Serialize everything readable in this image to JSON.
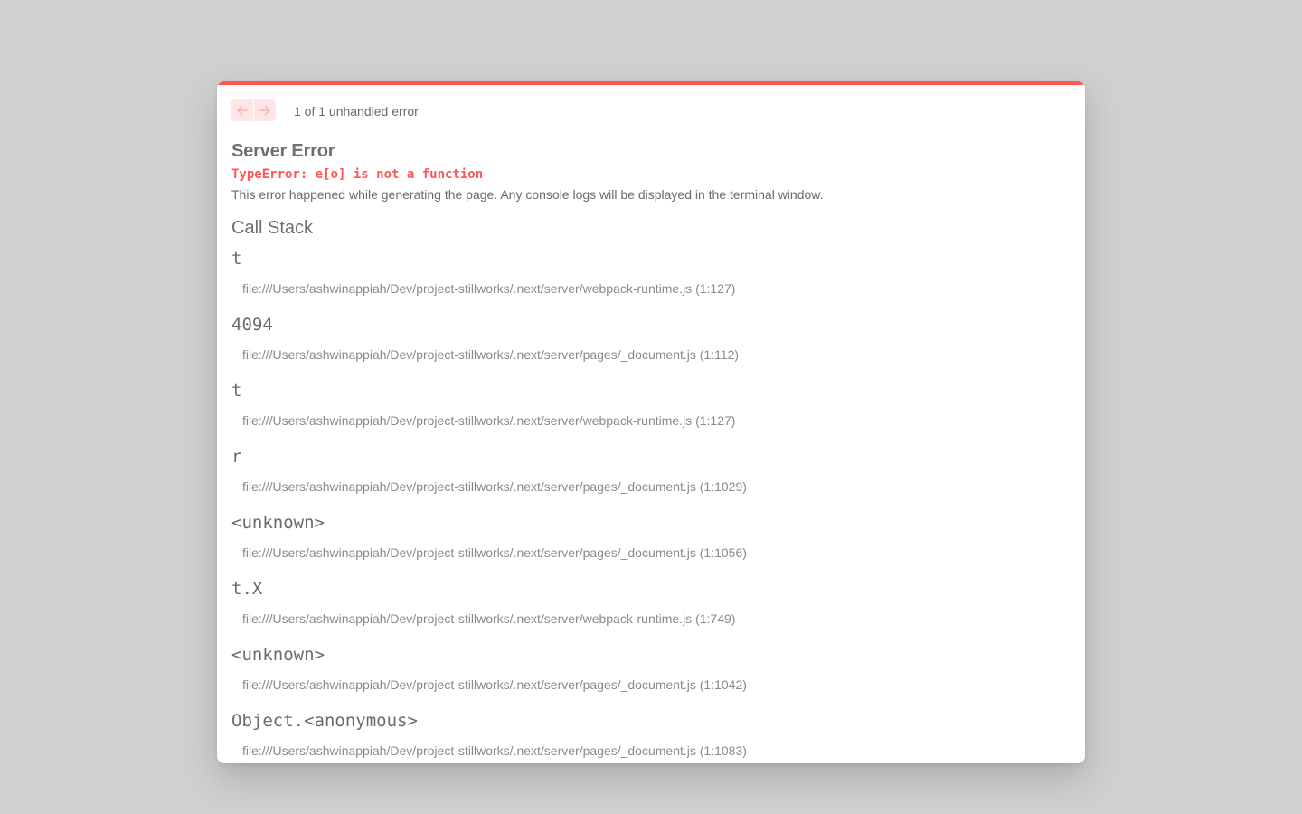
{
  "colors": {
    "accent": "#ff5555",
    "nav_button_bg": "#ffe5e5",
    "overlay_bg": "#d0d0d0",
    "text": "#6b6b6b"
  },
  "nav": {
    "prev_icon": "arrow-left-icon",
    "next_icon": "arrow-right-icon",
    "count_text": "1 of 1 unhandled error"
  },
  "error": {
    "title": "Server Error",
    "message": "TypeError: e[o] is not a function",
    "note": "This error happened while generating the page. Any console logs will be displayed in the terminal window."
  },
  "call_stack": {
    "title": "Call Stack",
    "frames": [
      {
        "fn": "t",
        "location": "file:///Users/ashwinappiah/Dev/project-stillworks/.next/server/webpack-runtime.js (1:127)"
      },
      {
        "fn": "4094",
        "location": "file:///Users/ashwinappiah/Dev/project-stillworks/.next/server/pages/_document.js (1:112)"
      },
      {
        "fn": "t",
        "location": "file:///Users/ashwinappiah/Dev/project-stillworks/.next/server/webpack-runtime.js (1:127)"
      },
      {
        "fn": "r",
        "location": "file:///Users/ashwinappiah/Dev/project-stillworks/.next/server/pages/_document.js (1:1029)"
      },
      {
        "fn": "<unknown>",
        "location": "file:///Users/ashwinappiah/Dev/project-stillworks/.next/server/pages/_document.js (1:1056)"
      },
      {
        "fn": "t.X",
        "location": "file:///Users/ashwinappiah/Dev/project-stillworks/.next/server/webpack-runtime.js (1:749)"
      },
      {
        "fn": "<unknown>",
        "location": "file:///Users/ashwinappiah/Dev/project-stillworks/.next/server/pages/_document.js (1:1042)"
      },
      {
        "fn": "Object.<anonymous>",
        "location": "file:///Users/ashwinappiah/Dev/project-stillworks/.next/server/pages/_document.js (1:1083)"
      }
    ]
  }
}
